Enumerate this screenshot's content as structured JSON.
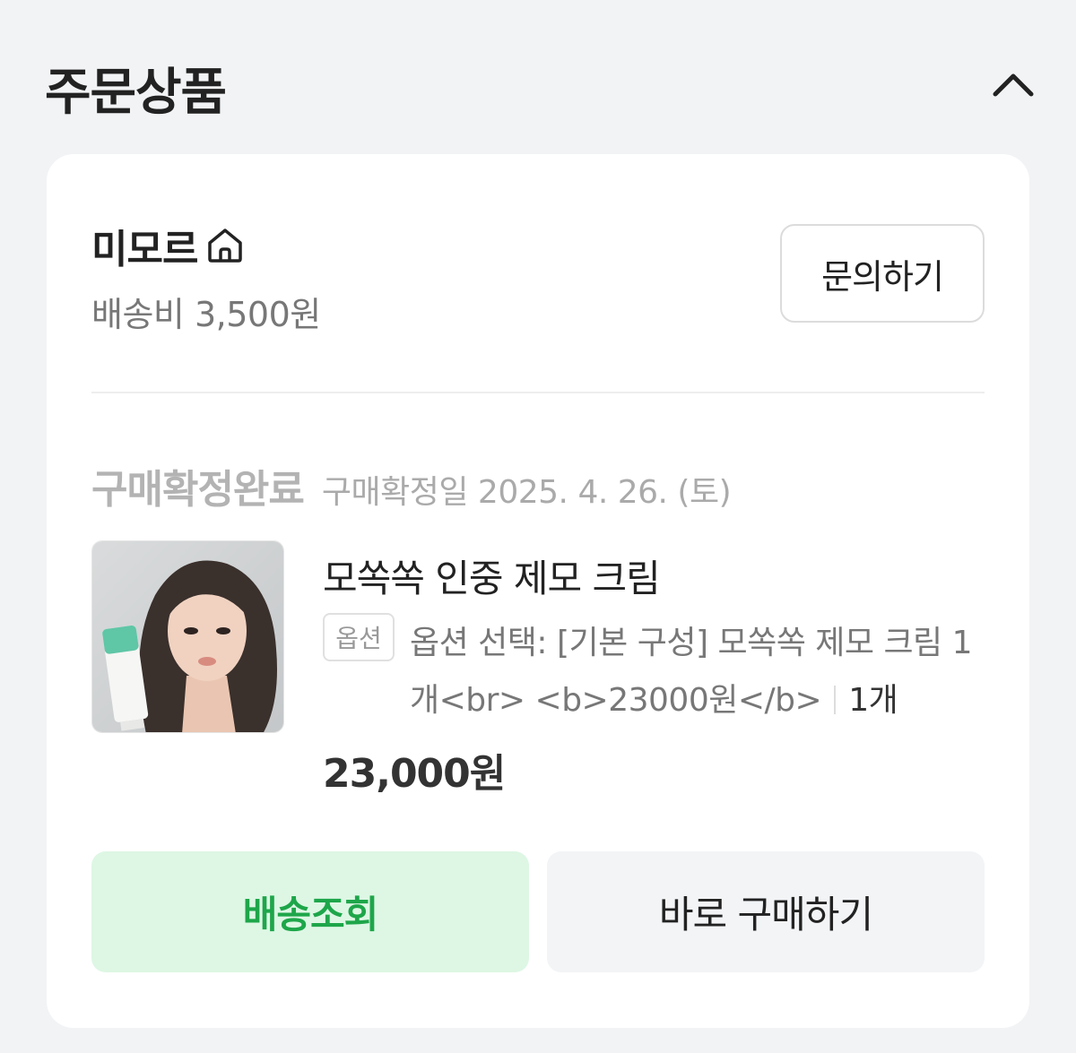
{
  "section": {
    "title": "주문상품",
    "collapse_icon": "chevron-up-icon"
  },
  "seller": {
    "name": "미모르",
    "store_icon": "home-icon",
    "shipping_fee": "배송비 3,500원",
    "inquiry_label": "문의하기"
  },
  "order": {
    "status": "구매확정완료",
    "confirm_date": "구매확정일 2025. 4. 26. (토)"
  },
  "product": {
    "name": "모쏙쏙 인중 제모 크림",
    "option_badge": "옵션",
    "option_text": "옵션 선택: [기본 구성] 모쏙쏙 제모 크림 1개<br> <b>23000원</b>",
    "quantity": "1개",
    "price": "23,000원",
    "image_alt": "product thumbnail"
  },
  "actions": {
    "track_label": "배송조회",
    "rebuy_label": "바로 구매하기"
  },
  "colors": {
    "accent_green": "#1ea64a",
    "accent_green_bg": "#ddf7e4",
    "page_bg": "#f2f3f5"
  }
}
